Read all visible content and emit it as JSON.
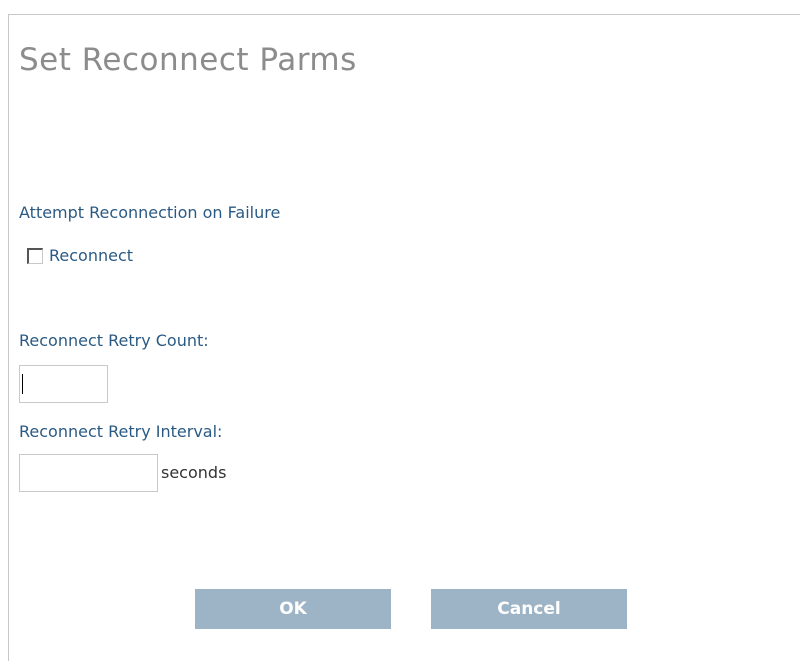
{
  "dialog": {
    "title": "Set Reconnect Parms",
    "section_label": "Attempt Reconnection on Failure",
    "reconnect_checkbox": {
      "label": "Reconnect",
      "checked": false
    },
    "retry_count": {
      "label": "Reconnect Retry Count:",
      "value": ""
    },
    "retry_interval": {
      "label": "Reconnect Retry Interval:",
      "value": "",
      "unit": "seconds"
    },
    "buttons": {
      "ok": "OK",
      "cancel": "Cancel"
    },
    "colors": {
      "title": "#8c8c8c",
      "label": "#2a5a84",
      "button_bg": "#9db3c6",
      "button_text": "#ffffff"
    }
  }
}
